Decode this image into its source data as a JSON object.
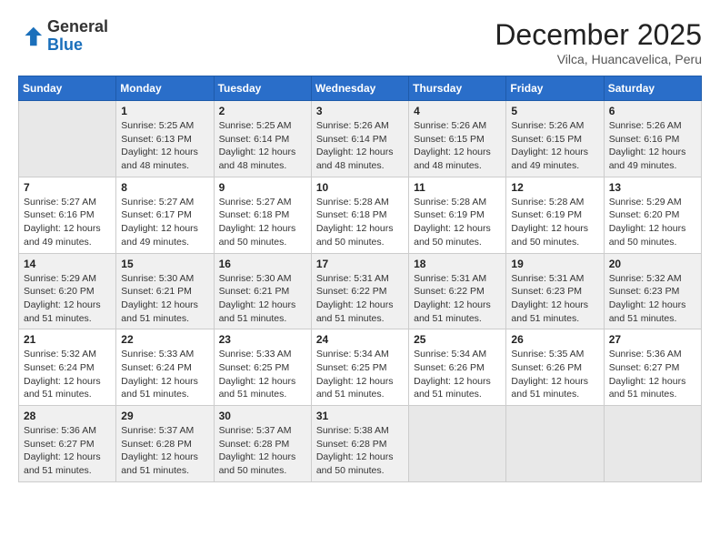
{
  "header": {
    "logo_general": "General",
    "logo_blue": "Blue",
    "month_title": "December 2025",
    "subtitle": "Vilca, Huancavelica, Peru"
  },
  "weekdays": [
    "Sunday",
    "Monday",
    "Tuesday",
    "Wednesday",
    "Thursday",
    "Friday",
    "Saturday"
  ],
  "weeks": [
    [
      {
        "day": "",
        "info": ""
      },
      {
        "day": "1",
        "info": "Sunrise: 5:25 AM\nSunset: 6:13 PM\nDaylight: 12 hours\nand 48 minutes."
      },
      {
        "day": "2",
        "info": "Sunrise: 5:25 AM\nSunset: 6:14 PM\nDaylight: 12 hours\nand 48 minutes."
      },
      {
        "day": "3",
        "info": "Sunrise: 5:26 AM\nSunset: 6:14 PM\nDaylight: 12 hours\nand 48 minutes."
      },
      {
        "day": "4",
        "info": "Sunrise: 5:26 AM\nSunset: 6:15 PM\nDaylight: 12 hours\nand 48 minutes."
      },
      {
        "day": "5",
        "info": "Sunrise: 5:26 AM\nSunset: 6:15 PM\nDaylight: 12 hours\nand 49 minutes."
      },
      {
        "day": "6",
        "info": "Sunrise: 5:26 AM\nSunset: 6:16 PM\nDaylight: 12 hours\nand 49 minutes."
      }
    ],
    [
      {
        "day": "7",
        "info": "Sunrise: 5:27 AM\nSunset: 6:16 PM\nDaylight: 12 hours\nand 49 minutes."
      },
      {
        "day": "8",
        "info": "Sunrise: 5:27 AM\nSunset: 6:17 PM\nDaylight: 12 hours\nand 49 minutes."
      },
      {
        "day": "9",
        "info": "Sunrise: 5:27 AM\nSunset: 6:18 PM\nDaylight: 12 hours\nand 50 minutes."
      },
      {
        "day": "10",
        "info": "Sunrise: 5:28 AM\nSunset: 6:18 PM\nDaylight: 12 hours\nand 50 minutes."
      },
      {
        "day": "11",
        "info": "Sunrise: 5:28 AM\nSunset: 6:19 PM\nDaylight: 12 hours\nand 50 minutes."
      },
      {
        "day": "12",
        "info": "Sunrise: 5:28 AM\nSunset: 6:19 PM\nDaylight: 12 hours\nand 50 minutes."
      },
      {
        "day": "13",
        "info": "Sunrise: 5:29 AM\nSunset: 6:20 PM\nDaylight: 12 hours\nand 50 minutes."
      }
    ],
    [
      {
        "day": "14",
        "info": "Sunrise: 5:29 AM\nSunset: 6:20 PM\nDaylight: 12 hours\nand 51 minutes."
      },
      {
        "day": "15",
        "info": "Sunrise: 5:30 AM\nSunset: 6:21 PM\nDaylight: 12 hours\nand 51 minutes."
      },
      {
        "day": "16",
        "info": "Sunrise: 5:30 AM\nSunset: 6:21 PM\nDaylight: 12 hours\nand 51 minutes."
      },
      {
        "day": "17",
        "info": "Sunrise: 5:31 AM\nSunset: 6:22 PM\nDaylight: 12 hours\nand 51 minutes."
      },
      {
        "day": "18",
        "info": "Sunrise: 5:31 AM\nSunset: 6:22 PM\nDaylight: 12 hours\nand 51 minutes."
      },
      {
        "day": "19",
        "info": "Sunrise: 5:31 AM\nSunset: 6:23 PM\nDaylight: 12 hours\nand 51 minutes."
      },
      {
        "day": "20",
        "info": "Sunrise: 5:32 AM\nSunset: 6:23 PM\nDaylight: 12 hours\nand 51 minutes."
      }
    ],
    [
      {
        "day": "21",
        "info": "Sunrise: 5:32 AM\nSunset: 6:24 PM\nDaylight: 12 hours\nand 51 minutes."
      },
      {
        "day": "22",
        "info": "Sunrise: 5:33 AM\nSunset: 6:24 PM\nDaylight: 12 hours\nand 51 minutes."
      },
      {
        "day": "23",
        "info": "Sunrise: 5:33 AM\nSunset: 6:25 PM\nDaylight: 12 hours\nand 51 minutes."
      },
      {
        "day": "24",
        "info": "Sunrise: 5:34 AM\nSunset: 6:25 PM\nDaylight: 12 hours\nand 51 minutes."
      },
      {
        "day": "25",
        "info": "Sunrise: 5:34 AM\nSunset: 6:26 PM\nDaylight: 12 hours\nand 51 minutes."
      },
      {
        "day": "26",
        "info": "Sunrise: 5:35 AM\nSunset: 6:26 PM\nDaylight: 12 hours\nand 51 minutes."
      },
      {
        "day": "27",
        "info": "Sunrise: 5:36 AM\nSunset: 6:27 PM\nDaylight: 12 hours\nand 51 minutes."
      }
    ],
    [
      {
        "day": "28",
        "info": "Sunrise: 5:36 AM\nSunset: 6:27 PM\nDaylight: 12 hours\nand 51 minutes."
      },
      {
        "day": "29",
        "info": "Sunrise: 5:37 AM\nSunset: 6:28 PM\nDaylight: 12 hours\nand 51 minutes."
      },
      {
        "day": "30",
        "info": "Sunrise: 5:37 AM\nSunset: 6:28 PM\nDaylight: 12 hours\nand 50 minutes."
      },
      {
        "day": "31",
        "info": "Sunrise: 5:38 AM\nSunset: 6:28 PM\nDaylight: 12 hours\nand 50 minutes."
      },
      {
        "day": "",
        "info": ""
      },
      {
        "day": "",
        "info": ""
      },
      {
        "day": "",
        "info": ""
      }
    ]
  ]
}
